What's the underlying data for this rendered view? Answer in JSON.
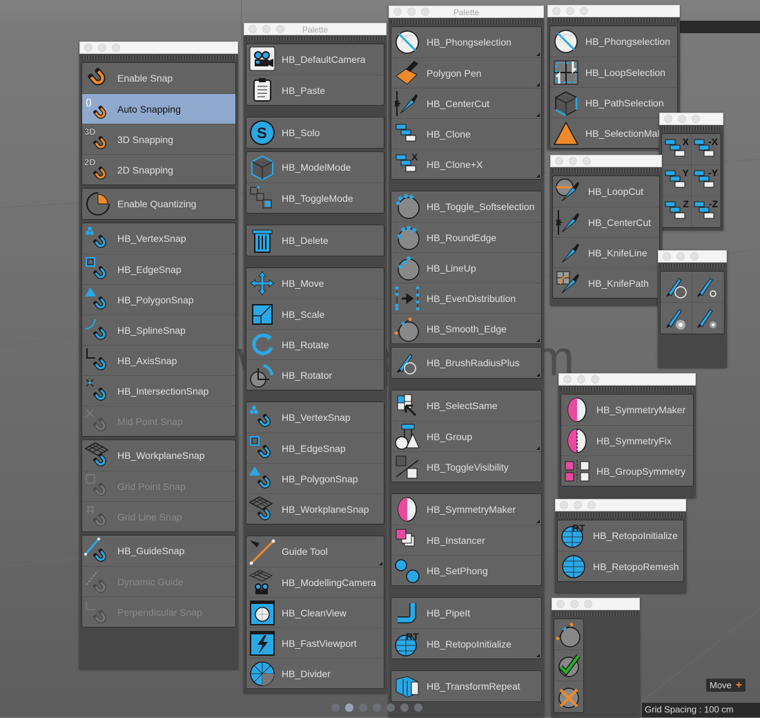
{
  "palette_title": "Palette",
  "colors": {
    "accent_blue": "#29a8e8",
    "accent_orange": "#ee8a2c",
    "magenta": "#e94aa0",
    "selected": "#8fa9cd",
    "green": "#22b02a"
  },
  "win1": {
    "groups": [
      [
        {
          "label": "Enable Snap",
          "icon": "magnet-orange-icon"
        },
        {
          "label": "Auto Snapping",
          "icon": "auto-snap-icon",
          "selected": true
        },
        {
          "label": "3D Snapping",
          "icon": "3d-snap-icon"
        },
        {
          "label": "2D Snapping",
          "icon": "2d-snap-icon"
        }
      ],
      [
        {
          "label": "Enable Quantizing",
          "icon": "quantize-icon"
        }
      ],
      [
        {
          "label": "HB_VertexSnap",
          "icon": "vertex-snap-icon"
        },
        {
          "label": "HB_EdgeSnap",
          "icon": "edge-snap-icon"
        },
        {
          "label": "HB_PolygonSnap",
          "icon": "polygon-snap-icon"
        },
        {
          "label": "HB_SplineSnap",
          "icon": "spline-snap-icon"
        },
        {
          "label": "HB_AxisSnap",
          "icon": "axis-snap-icon"
        },
        {
          "label": "HB_IntersectionSnap",
          "icon": "intersection-snap-icon"
        },
        {
          "label": "Mid Point Snap",
          "icon": "midpoint-snap-icon",
          "disabled": true
        }
      ],
      [
        {
          "label": "HB_WorkplaneSnap",
          "icon": "workplane-snap-icon"
        },
        {
          "label": "Grid Point Snap",
          "icon": "grid-point-snap-icon",
          "disabled": true
        },
        {
          "label": "Grid Line Snap",
          "icon": "grid-line-snap-icon",
          "disabled": true
        }
      ],
      [
        {
          "label": "HB_GuideSnap",
          "icon": "guide-snap-icon"
        },
        {
          "label": "Dynamic Guide",
          "icon": "dynamic-guide-icon",
          "disabled": true
        },
        {
          "label": "Perpendicular Snap",
          "icon": "perpendicular-snap-icon",
          "disabled": true
        }
      ]
    ]
  },
  "win2": {
    "title": "Palette",
    "groups": [
      [
        {
          "label": "HB_DefaultCamera",
          "icon": "camera-icon"
        },
        {
          "label": "HB_Paste",
          "icon": "paste-icon"
        }
      ],
      [
        {
          "label": "HB_Solo",
          "icon": "solo-icon"
        }
      ],
      [
        {
          "label": "HB_ModelMode",
          "icon": "cube-icon"
        },
        {
          "label": "HB_ToggleMode",
          "icon": "toggle-mode-icon"
        }
      ],
      [
        {
          "label": "HB_Delete",
          "icon": "trash-icon"
        }
      ],
      [
        {
          "label": "HB_Move",
          "icon": "move-icon"
        },
        {
          "label": "HB_Scale",
          "icon": "scale-icon"
        },
        {
          "label": "HB_Rotate",
          "icon": "rotate-icon"
        },
        {
          "label": "HB_Rotator",
          "icon": "rotator-icon"
        }
      ],
      [
        {
          "label": "HB_VertexSnap",
          "icon": "vertex-snap-icon"
        },
        {
          "label": "HB_EdgeSnap",
          "icon": "edge-snap-icon"
        },
        {
          "label": "HB_PolygonSnap",
          "icon": "polygon-snap-icon"
        },
        {
          "label": "HB_WorkplaneSnap",
          "icon": "workplane-snap-icon"
        }
      ],
      [
        {
          "label": "Guide Tool",
          "icon": "guide-tool-icon",
          "corner": true
        },
        {
          "label": "HB_ModellingCamera",
          "icon": "modelling-camera-icon"
        },
        {
          "label": "HB_CleanView",
          "icon": "clean-view-icon"
        },
        {
          "label": "HB_FastViewport",
          "icon": "fast-viewport-icon"
        },
        {
          "label": "HB_Divider",
          "icon": "divider-icon"
        }
      ]
    ]
  },
  "win3": {
    "title": "Palette",
    "groups": [
      [
        {
          "label": "HB_Phongselection",
          "icon": "phong-selection-icon",
          "corner": true
        },
        {
          "label": "Polygon Pen",
          "icon": "polygon-pen-icon",
          "corner": true
        },
        {
          "label": "HB_CenterCut",
          "icon": "center-cut-icon",
          "corner": true
        },
        {
          "label": "HB_Clone",
          "icon": "clone-icon"
        },
        {
          "label": "HB_Clone+X",
          "icon": "clone-x-icon",
          "corner": true
        }
      ],
      [
        {
          "label": "HB_Toggle_Softselection",
          "icon": "soft-selection-icon"
        },
        {
          "label": "HB_RoundEdge",
          "icon": "round-edge-icon"
        },
        {
          "label": "HB_LineUp",
          "icon": "line-up-icon"
        },
        {
          "label": "HB_EvenDistribution",
          "icon": "even-distribution-icon"
        },
        {
          "label": "HB_Smooth_Edge",
          "icon": "smooth-edge-icon",
          "corner": true
        }
      ],
      [
        {
          "label": "HB_BrushRadiusPlus",
          "icon": "brush-radius-icon",
          "corner": true
        }
      ],
      [
        {
          "label": "HB_SelectSame",
          "icon": "select-same-icon"
        },
        {
          "label": "HB_Group",
          "icon": "group-icon",
          "corner": true
        },
        {
          "label": "HB_ToggleVisibility",
          "icon": "toggle-visibility-icon"
        }
      ],
      [
        {
          "label": "HB_SymmetryMaker",
          "icon": "symmetry-maker-icon",
          "corner": true
        },
        {
          "label": "HB_Instancer",
          "icon": "instancer-icon"
        },
        {
          "label": "HB_SetPhong",
          "icon": "set-phong-icon"
        }
      ],
      [
        {
          "label": "HB_PipeIt",
          "icon": "pipe-icon"
        },
        {
          "label": "HB_RetopoInitialize",
          "icon": "retopo-init-icon",
          "corner": true
        }
      ],
      [
        {
          "label": "HB_TransformRepeat",
          "icon": "transform-repeat-icon"
        }
      ]
    ]
  },
  "win4": {
    "groups": [
      [
        {
          "label": "HB_Phongselection",
          "icon": "phong-selection-icon"
        },
        {
          "label": "HB_LoopSelection",
          "icon": "loop-selection-icon"
        },
        {
          "label": "HB_PathSelection",
          "icon": "path-selection-icon"
        },
        {
          "label": "HB_SelectionMaker",
          "icon": "selection-maker-icon"
        }
      ]
    ]
  },
  "win5": {
    "groups": [
      [
        {
          "label": "HB_LoopCut",
          "icon": "loop-cut-icon"
        },
        {
          "label": "HB_CenterCut",
          "icon": "center-cut-icon"
        },
        {
          "label": "HB_KnifeLine",
          "icon": "knife-line-icon"
        },
        {
          "label": "HB_KnifePath",
          "icon": "knife-path-icon"
        }
      ]
    ]
  },
  "win6": {
    "cells": [
      {
        "axis": "X"
      },
      {
        "axis": "-X"
      },
      {
        "axis": "Y"
      },
      {
        "axis": "-Y"
      },
      {
        "axis": "Z"
      },
      {
        "axis": "-Z"
      }
    ]
  },
  "win7": {
    "cells": [
      {
        "icon": "brush-large-ring-icon"
      },
      {
        "icon": "brush-small-ring-icon"
      },
      {
        "icon": "brush-large-soft-icon"
      },
      {
        "icon": "brush-small-soft-icon"
      }
    ]
  },
  "win8": {
    "groups": [
      [
        {
          "label": "HB_SymmetryMaker",
          "icon": "symmetry-maker-icon"
        },
        {
          "label": "HB_SymmetryFix",
          "icon": "symmetry-fix-icon"
        },
        {
          "label": "HB_GroupSymmetry",
          "icon": "group-symmetry-icon"
        }
      ]
    ]
  },
  "win9": {
    "groups": [
      [
        {
          "label": "HB_RetopoInitialize",
          "icon": "retopo-init-icon"
        },
        {
          "label": "HB_RetopoRemesh",
          "icon": "retopo-remesh-icon"
        }
      ]
    ]
  },
  "win10": {
    "cells": [
      {
        "icon": "smooth-sphere-icon"
      },
      {
        "icon": "confirm-check-icon"
      },
      {
        "icon": "cancel-x-icon"
      }
    ]
  },
  "hud": {
    "move_label": "Move",
    "grid_spacing": "Grid Spacing : 100 cm"
  },
  "watermark": "www.cgalpha.com",
  "pager": {
    "count": 7,
    "active": 1
  }
}
